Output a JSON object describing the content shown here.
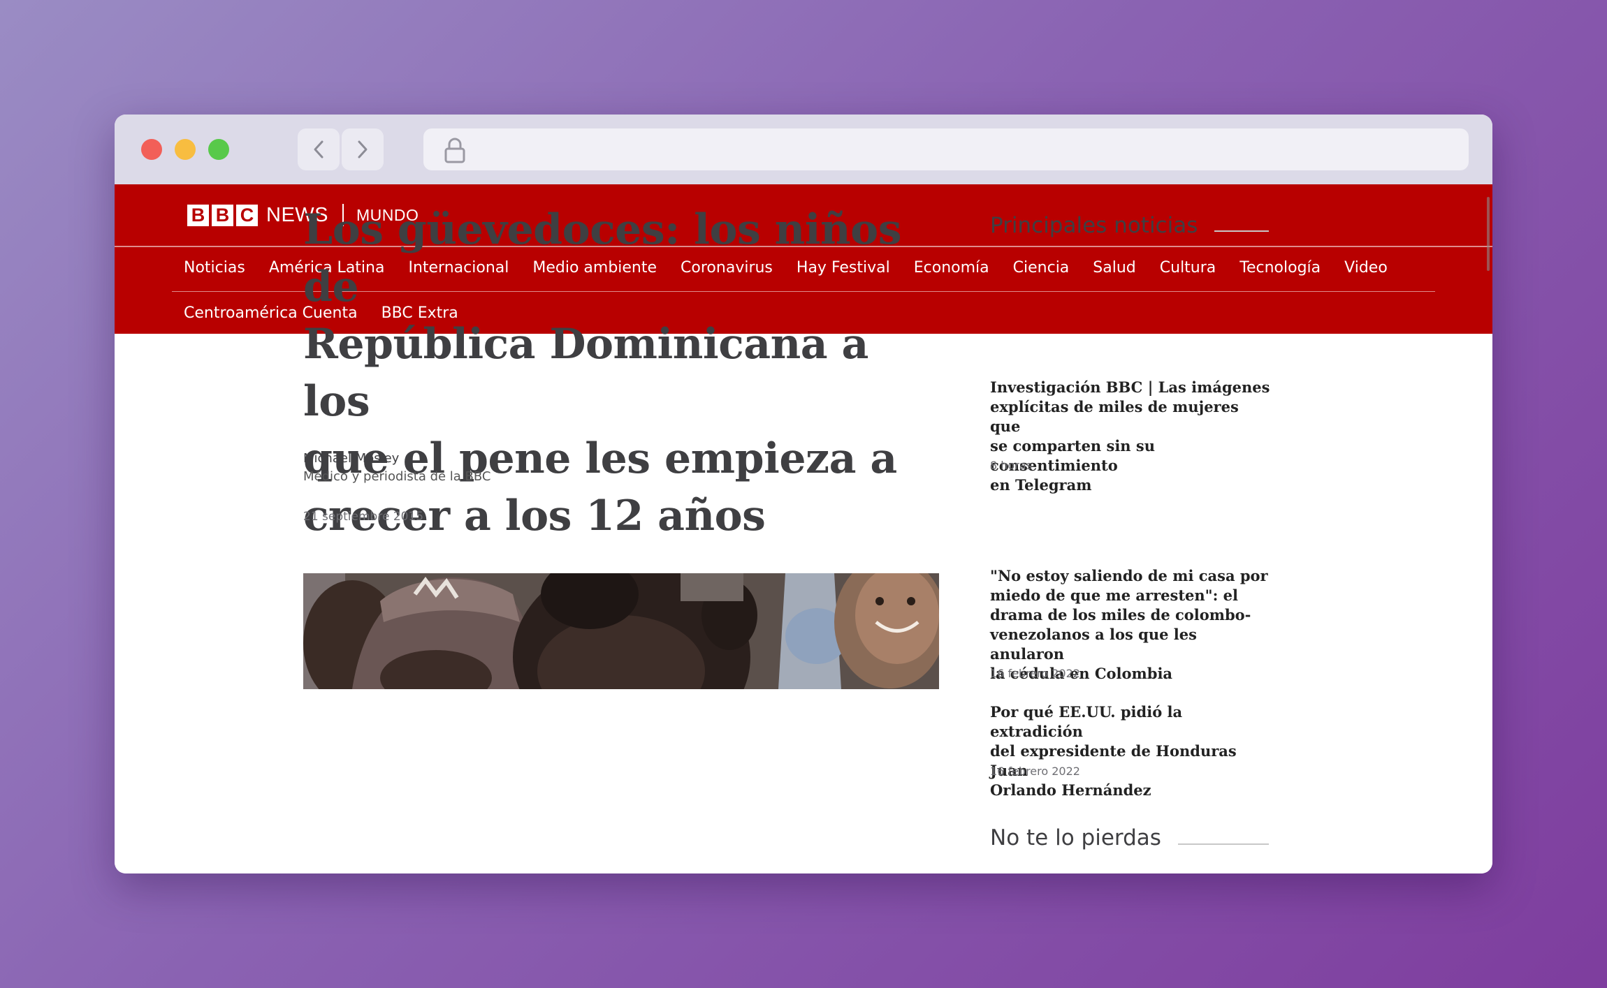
{
  "browser": {
    "back_icon": "chevron-left-icon",
    "forward_icon": "chevron-right-icon",
    "lock_icon": "lock-icon",
    "url": ""
  },
  "brand": {
    "bbc_letters": [
      "B",
      "B",
      "C"
    ],
    "news": "NEWS",
    "section": "MUNDO",
    "color": "#b80000"
  },
  "nav": {
    "row1": [
      "Noticias",
      "América Latina",
      "Internacional",
      "Medio ambiente",
      "Coronavirus",
      "Hay Festival",
      "Economía",
      "Ciencia",
      "Salud",
      "Cultura",
      "Tecnología",
      "Video"
    ],
    "row2": [
      "Centroamérica Cuenta",
      "BBC Extra"
    ]
  },
  "article": {
    "headline_lines": [
      "Los güevedoces: los niños de",
      "República Dominicana a los",
      "que el pene les empieza a",
      "crecer a los 12 años"
    ],
    "author": "Michael Mosley",
    "author_role": "Médico y periodista de la BBC",
    "date": "21 septiembre 2015"
  },
  "sidebar": {
    "top_heading": "Principales noticias",
    "items": [
      {
        "title_lines": [
          "Investigación BBC | Las imágenes",
          "explícitas de miles de mujeres que",
          "se comparten sin su consentimiento",
          "en Telegram"
        ],
        "time": "8 horas"
      },
      {
        "title_lines": [
          "\"No estoy saliendo de mi casa por",
          "miedo de que me arresten\": el",
          "drama de los miles de colombo-",
          "venezolanos a los que les anularon",
          "la cédula en Colombia"
        ],
        "time": "16 febrero 2022"
      },
      {
        "title_lines": [
          "Por qué EE.UU. pidió la extradición",
          "del expresidente de Honduras Juan",
          "Orlando Hernández"
        ],
        "time": "16 febrero 2022"
      }
    ],
    "second_heading": "No te lo pierdas"
  }
}
